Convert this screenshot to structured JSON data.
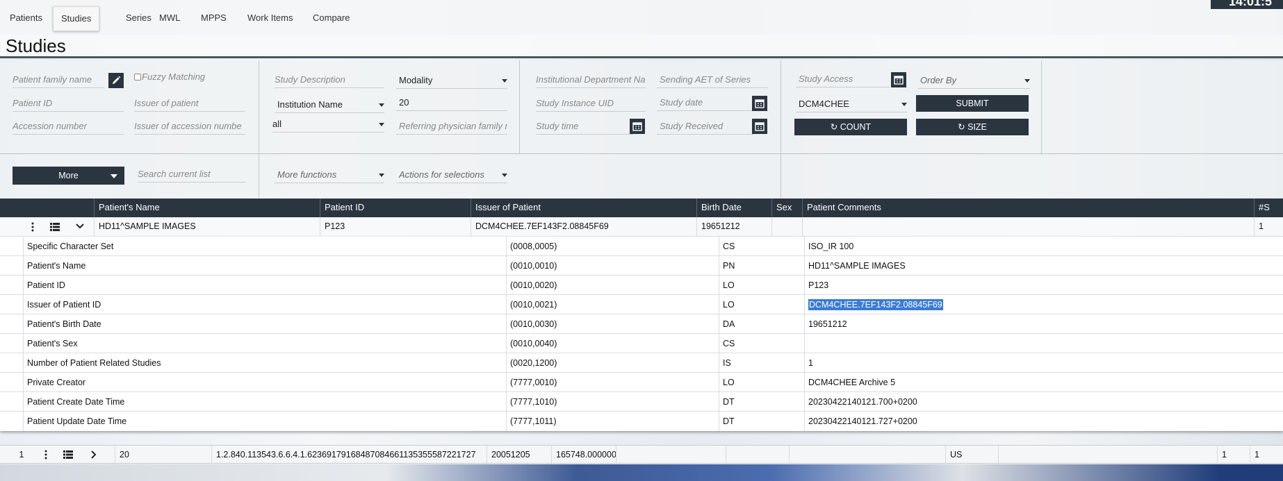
{
  "nav": {
    "tabs": [
      "Patients",
      "Studies",
      "Series",
      "MWL",
      "MPPS",
      "Work Items",
      "Compare"
    ],
    "active_tab": "Studies",
    "clock": "14:01:5"
  },
  "page_title": "Studies",
  "filters": {
    "patient_family_name": "Patient family name",
    "fuzzy_matching": "Fuzzy Matching",
    "patient_id": "Patient ID",
    "issuer_of_patient": "Issuer of patient",
    "accession_number": "Accession number",
    "issuer_of_accession": "Issuer of accession numbe",
    "study_description": "Study Description",
    "modality": "Modality",
    "institution_name": "Institution Name",
    "limit": "20",
    "all": "all",
    "referring_physician": "Referring physician family n",
    "institutional_department": "Institutional Department Na",
    "sending_aet": "Sending AET of Series",
    "study_instance_uid": "Study Instance UID",
    "study_date": "Study date",
    "study_time": "Study time",
    "study_received": "Study Received",
    "study_access": "Study Access",
    "order_by": "Order By",
    "aet": "DCM4CHEE",
    "submit": "SUBMIT",
    "count": "COUNT",
    "size": "SIZE",
    "more": "More",
    "search_current_list": "Search current list",
    "more_functions": "More functions",
    "actions_for_selections": "Actions for selections"
  },
  "table": {
    "headers": [
      "Patient's Name",
      "Patient ID",
      "Issuer of Patient",
      "Birth Date",
      "Sex",
      "Patient Comments",
      "#S"
    ],
    "patient_row": [
      "HD11^SAMPLE IMAGES",
      "P123",
      "DCM4CHEE.7EF143F2.08845F69",
      "19651212",
      "",
      "",
      "1"
    ]
  },
  "attributes": [
    {
      "name": "Specific Character Set",
      "tag": "(0008,0005)",
      "vr": "CS",
      "value": "ISO_IR 100"
    },
    {
      "name": "Patient's Name",
      "tag": "(0010,0010)",
      "vr": "PN",
      "value": "HD11^SAMPLE IMAGES"
    },
    {
      "name": "Patient ID",
      "tag": "(0010,0020)",
      "vr": "LO",
      "value": "P123"
    },
    {
      "name": "Issuer of Patient ID",
      "tag": "(0010,0021)",
      "vr": "LO",
      "value": "DCM4CHEE.7EF143F2.08845F69"
    },
    {
      "name": "Patient's Birth Date",
      "tag": "(0010,0030)",
      "vr": "DA",
      "value": "19651212"
    },
    {
      "name": "Patient's Sex",
      "tag": "(0010,0040)",
      "vr": "CS",
      "value": ""
    },
    {
      "name": "Number of Patient Related Studies",
      "tag": "(0020,1200)",
      "vr": "IS",
      "value": "1"
    },
    {
      "name": "Private Creator",
      "tag": "(7777,0010)",
      "vr": "LO",
      "value": "DCM4CHEE Archive 5"
    },
    {
      "name": "Patient Create Date Time",
      "tag": "(7777,1010)",
      "vr": "DT",
      "value": "20230422140121.700+0200"
    },
    {
      "name": "Patient Update Date Time",
      "tag": "(7777,1011)",
      "vr": "DT",
      "value": "20230422140121.727+0200"
    }
  ],
  "study_row": {
    "index": "1",
    "id": "20",
    "uid": "1.2.840.113543.6.6.4.1.62369179168487084661135355587221727",
    "date": "20051205",
    "time": "165748.000000",
    "modality": "US",
    "series_count": "1",
    "instances": "1"
  },
  "colors": {
    "dark": "#2b3540",
    "highlight": "#3a7bd5"
  }
}
